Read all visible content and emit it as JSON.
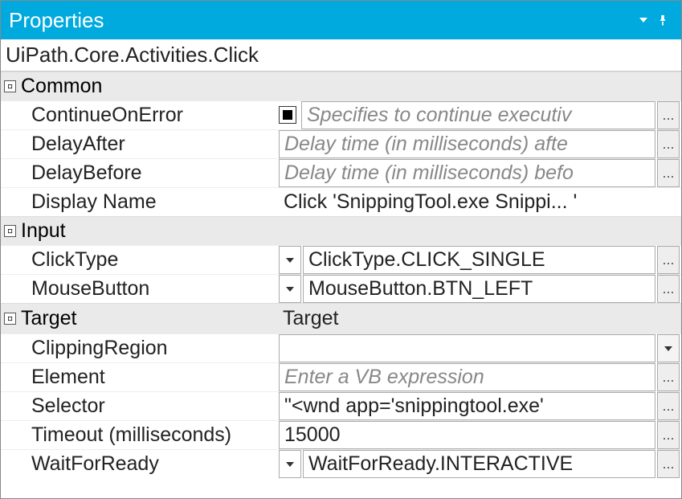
{
  "panel": {
    "title": "Properties",
    "activity": "UiPath.Core.Activities.Click"
  },
  "sections": {
    "common": {
      "header": "Common",
      "rows": {
        "continueOnError": {
          "label": "ContinueOnError",
          "placeholder": "Specifies to continue executiv"
        },
        "delayAfter": {
          "label": "DelayAfter",
          "placeholder": "Delay time (in milliseconds) afte"
        },
        "delayBefore": {
          "label": "DelayBefore",
          "placeholder": "Delay time (in milliseconds) befo"
        },
        "displayName": {
          "label": "Display Name",
          "value": "Click 'SnippingTool.exe Snippi... '"
        }
      }
    },
    "input": {
      "header": "Input",
      "rows": {
        "clickType": {
          "label": "ClickType",
          "value": "ClickType.CLICK_SINGLE"
        },
        "mouseButton": {
          "label": "MouseButton",
          "value": "MouseButton.BTN_LEFT"
        }
      }
    },
    "target": {
      "header": "Target",
      "value": "Target",
      "rows": {
        "clippingRegion": {
          "label": "ClippingRegion",
          "value": ""
        },
        "element": {
          "label": "Element",
          "placeholder": "Enter a VB expression"
        },
        "selector": {
          "label": "Selector",
          "value": "\"<wnd app='snippingtool.exe' "
        },
        "timeout": {
          "label": "Timeout (milliseconds)",
          "value": "15000"
        },
        "waitForReady": {
          "label": "WaitForReady",
          "value": "WaitForReady.INTERACTIVE"
        }
      }
    }
  }
}
